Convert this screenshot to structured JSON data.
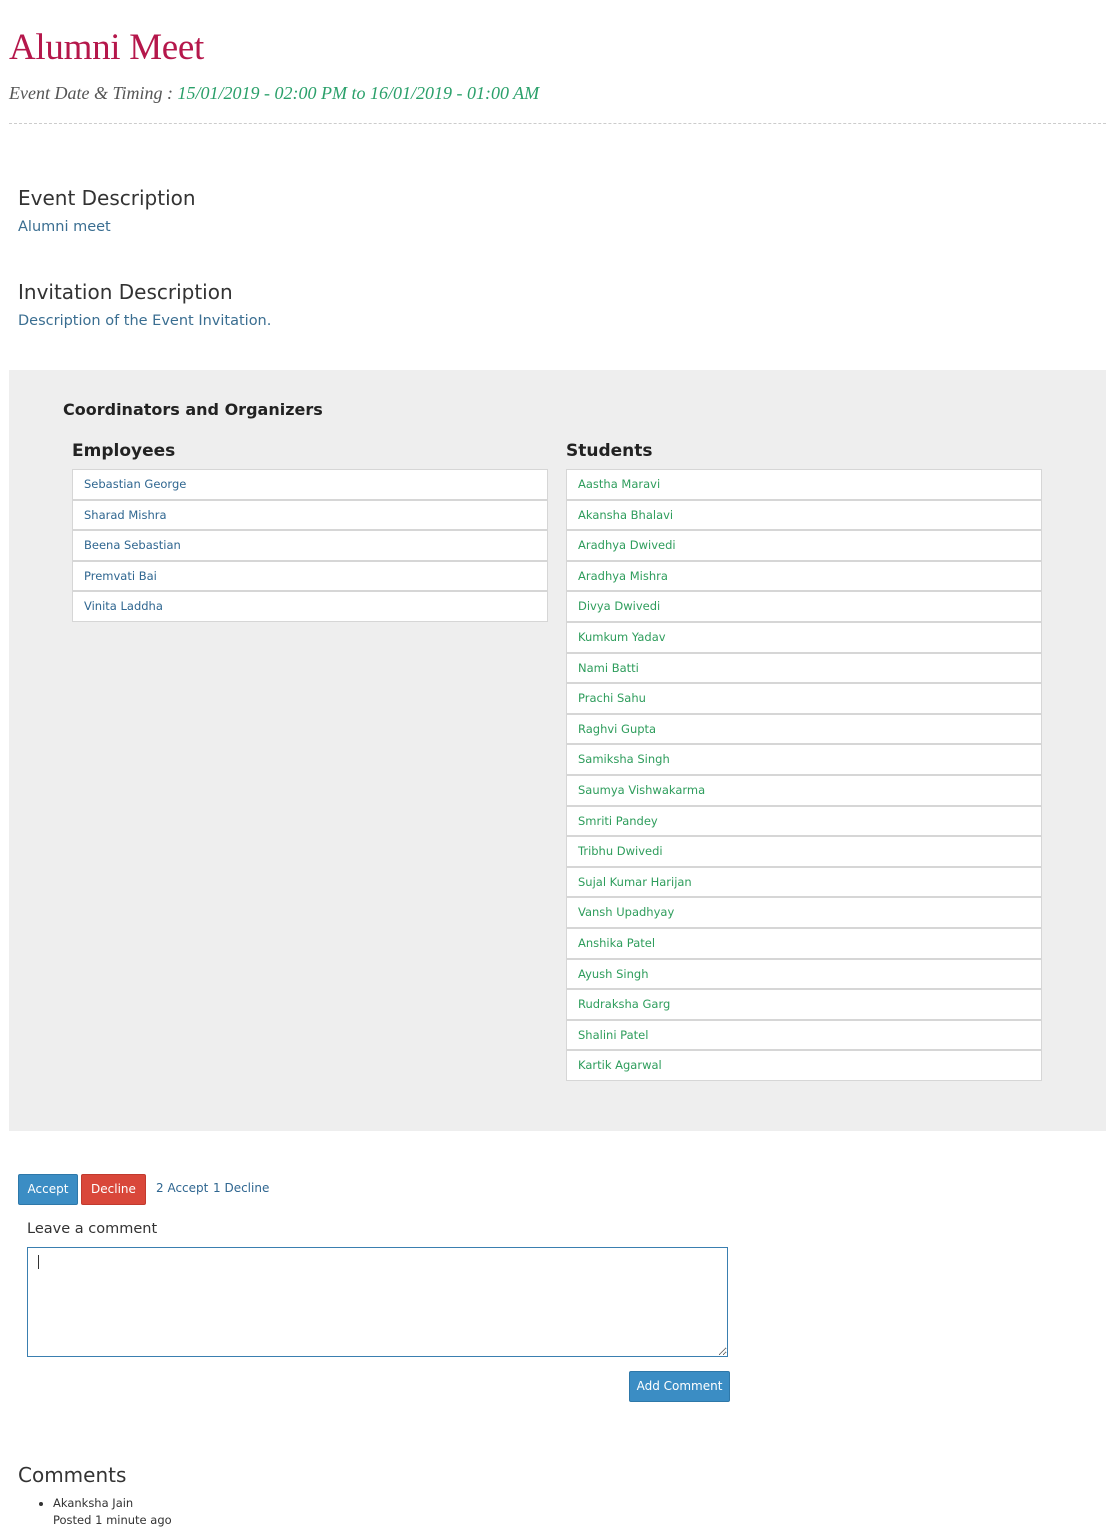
{
  "event": {
    "title": "Alumni Meet",
    "timing_label": "Event Date & Timing : ",
    "timing_value": "15/01/2019 - 02:00 PM to 16/01/2019 - 01:00 AM"
  },
  "event_description": {
    "heading": "Event Description",
    "text": "Alumni meet"
  },
  "invitation_description": {
    "heading": "Invitation Description",
    "text": "Description of the Event Invitation."
  },
  "coordinators": {
    "title": "Coordinators and Organizers",
    "employees_heading": "Employees",
    "employees": [
      "Sebastian George",
      "Sharad Mishra",
      "Beena Sebastian",
      "Premvati Bai",
      "Vinita Laddha"
    ],
    "students_heading": "Students",
    "students": [
      "Aastha Maravi",
      "Akansha Bhalavi",
      "Aradhya Dwivedi",
      "Aradhya Mishra",
      "Divya Dwivedi",
      "Kumkum Yadav",
      "Nami Batti",
      "Prachi Sahu",
      "Raghvi Gupta",
      "Samiksha Singh",
      "Saumya Vishwakarma",
      "Smriti Pandey",
      "Tribhu Dwivedi",
      "Sujal Kumar Harijan",
      "Vansh Upadhyay",
      "Anshika Patel",
      "Ayush Singh",
      "Rudraksha Garg",
      "Shalini Patel",
      "Kartik Agarwal"
    ]
  },
  "rsvp": {
    "accept_label": "Accept",
    "decline_label": "Decline",
    "accept_count": "2 Accept",
    "decline_count": "1 Decline"
  },
  "comment_form": {
    "label": "Leave a comment",
    "value": "",
    "submit_label": "Add Comment"
  },
  "comments": {
    "heading": "Comments",
    "items": [
      {
        "author": "Akanksha Jain",
        "posted": "Posted 1 minute ago"
      }
    ]
  },
  "colors": {
    "title": "#b5174b",
    "timing_value": "#2aa06a",
    "employee_link": "#2f6690",
    "student_link": "#2e9d5c",
    "accept_button": "#3b8dc4",
    "decline_button": "#d9473a",
    "panel_bg": "#eeeeee"
  }
}
